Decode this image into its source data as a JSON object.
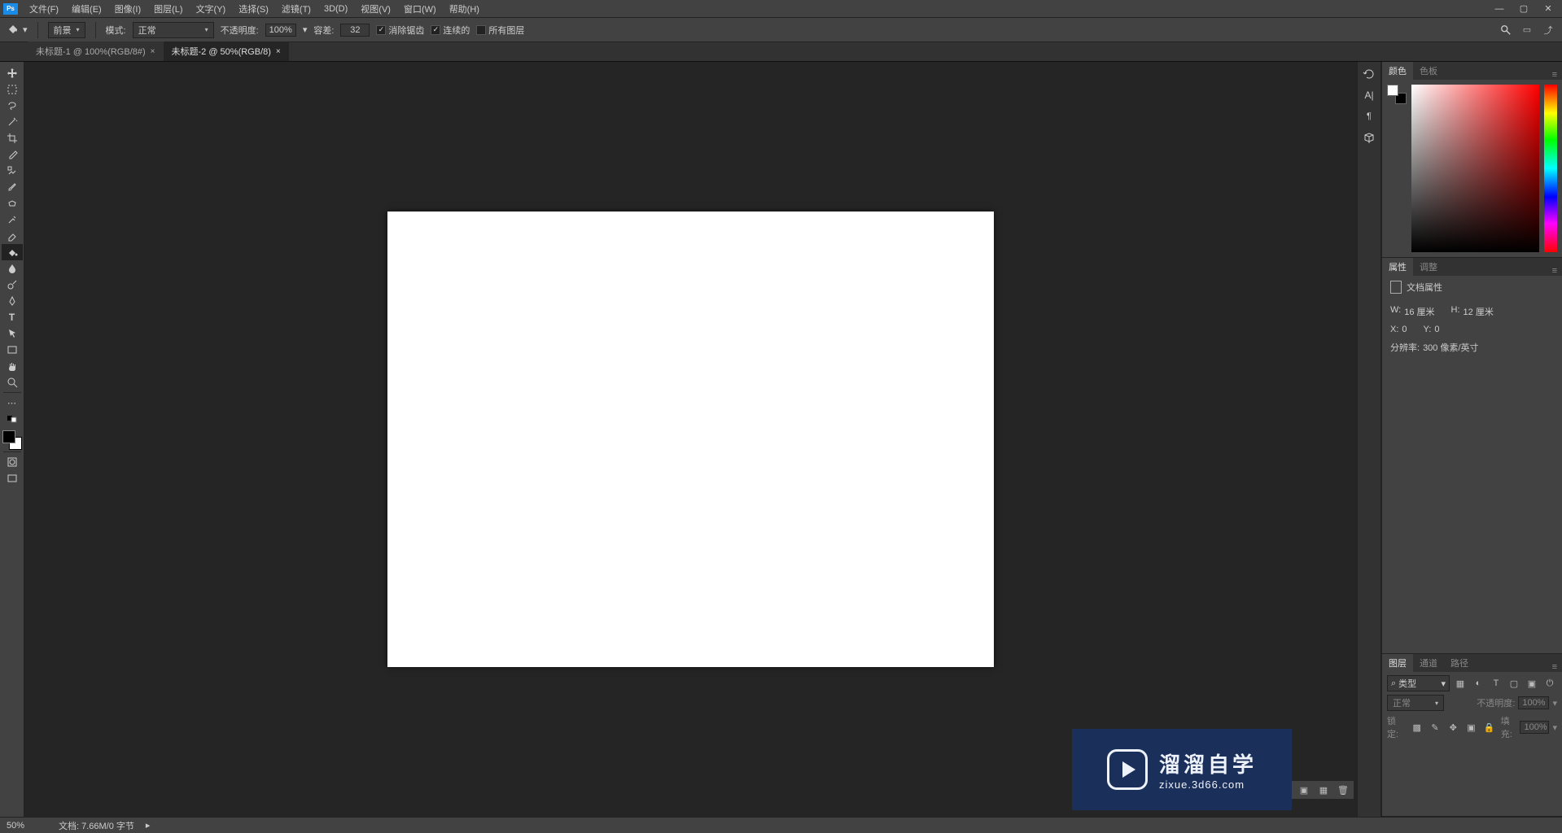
{
  "app": {
    "icon_text": "Ps"
  },
  "menu": {
    "file": "文件(F)",
    "edit": "编辑(E)",
    "image": "图像(I)",
    "layer": "图层(L)",
    "type": "文字(Y)",
    "select": "选择(S)",
    "filter": "滤镜(T)",
    "threeD": "3D(D)",
    "view": "视图(V)",
    "window": "窗口(W)",
    "help": "帮助(H)"
  },
  "optionbar": {
    "foreground_label": "前景",
    "mode_label": "模式:",
    "mode_value": "正常",
    "opacity_label": "不透明度:",
    "opacity_value": "100%",
    "tolerance_label": "容差:",
    "tolerance_value": "32",
    "antialias": "消除锯齿",
    "contiguous": "连续的",
    "all_layers": "所有图层"
  },
  "tabs": [
    {
      "label": "未标题-1 @ 100%(RGB/8#)",
      "active": false
    },
    {
      "label": "未标题-2 @ 50%(RGB/8)",
      "active": true
    }
  ],
  "panels": {
    "color": {
      "tab1": "颜色",
      "tab2": "色板"
    },
    "properties": {
      "tab1": "属性",
      "tab2": "调整",
      "doc_props": "文档属性",
      "w_label": "W:",
      "w_value": "16 厘米",
      "h_label": "H:",
      "h_value": "12 厘米",
      "x_label": "X:",
      "x_value": "0",
      "y_label": "Y:",
      "y_value": "0",
      "res_label": "分辨率:",
      "res_value": "300 像素/英寸"
    },
    "layers": {
      "tab1": "图层",
      "tab2": "通道",
      "tab3": "路径",
      "filter_kind": "类型",
      "blend_mode": "正常",
      "opacity_label": "不透明度:",
      "opacity_value": "100%",
      "lock_label": "锁定:",
      "fill_label": "填充:",
      "fill_value": "100%"
    }
  },
  "status": {
    "zoom": "50%",
    "doc_info": "文档: 7.66M/0 字节"
  },
  "watermark": {
    "title": "溜溜自学",
    "url": "zixue.3d66.com"
  }
}
